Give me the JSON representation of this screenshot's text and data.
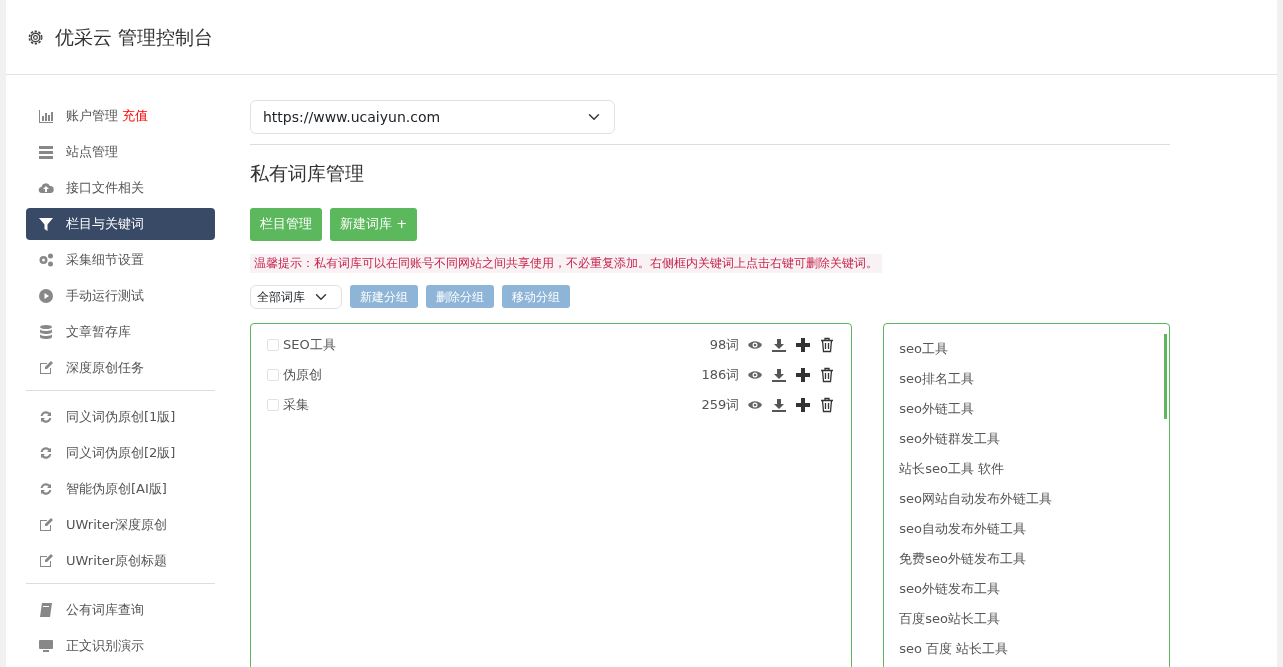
{
  "header": {
    "title": "优采云 管理控制台"
  },
  "sidebar": {
    "groups": [
      [
        {
          "label": "账户管理",
          "tag": "充值",
          "selected": false
        },
        {
          "label": "站点管理",
          "selected": false
        },
        {
          "label": "接口文件相关",
          "selected": false
        },
        {
          "label": "栏目与关键词",
          "selected": true
        },
        {
          "label": "采集细节设置",
          "selected": false
        },
        {
          "label": "手动运行测试",
          "selected": false
        },
        {
          "label": "文章暂存库",
          "selected": false
        },
        {
          "label": "深度原创任务",
          "selected": false
        }
      ],
      [
        {
          "label": "同义词伪原创[1版]",
          "selected": false
        },
        {
          "label": "同义词伪原创[2版]",
          "selected": false
        },
        {
          "label": "智能伪原创[AI版]",
          "selected": false
        },
        {
          "label": "UWriter深度原创",
          "selected": false
        },
        {
          "label": "UWriter原创标题",
          "selected": false
        }
      ],
      [
        {
          "label": "公有词库查询",
          "selected": false
        },
        {
          "label": "正文识别演示",
          "selected": false
        }
      ]
    ]
  },
  "site_select": {
    "value": "https://www.ucaiyun.com"
  },
  "heading": "私有词库管理",
  "actions": [
    "栏目管理",
    "新建词库 +"
  ],
  "notice": "温馨提示：私有词库可以在同账号不同网站之间共享使用，不必重复添加。右侧框内关键词上点击右键可删除关键词。",
  "toolbar": {
    "filter": "全部词库",
    "buttons": [
      {
        "label": "新建分组",
        "disabled": true
      },
      {
        "label": "删除分组",
        "disabled": true
      },
      {
        "label": "移动分组",
        "disabled": true
      }
    ]
  },
  "libraries": [
    {
      "name": "SEO工具",
      "count": "98词",
      "checked": false
    },
    {
      "name": "伪原创",
      "count": "186词",
      "checked": false
    },
    {
      "name": "采集",
      "count": "259词",
      "checked": false
    }
  ],
  "keywords": [
    "seo工具",
    "seo排名工具",
    "seo外链工具",
    "seo外链群发工具",
    "站长seo工具 软件",
    "seo网站自动发布外链工具",
    "seo自动发布外链工具",
    "免费seo外链发布工具",
    "seo外链发布工具",
    "百度seo站长工具",
    "seo 百度 站长工具"
  ]
}
